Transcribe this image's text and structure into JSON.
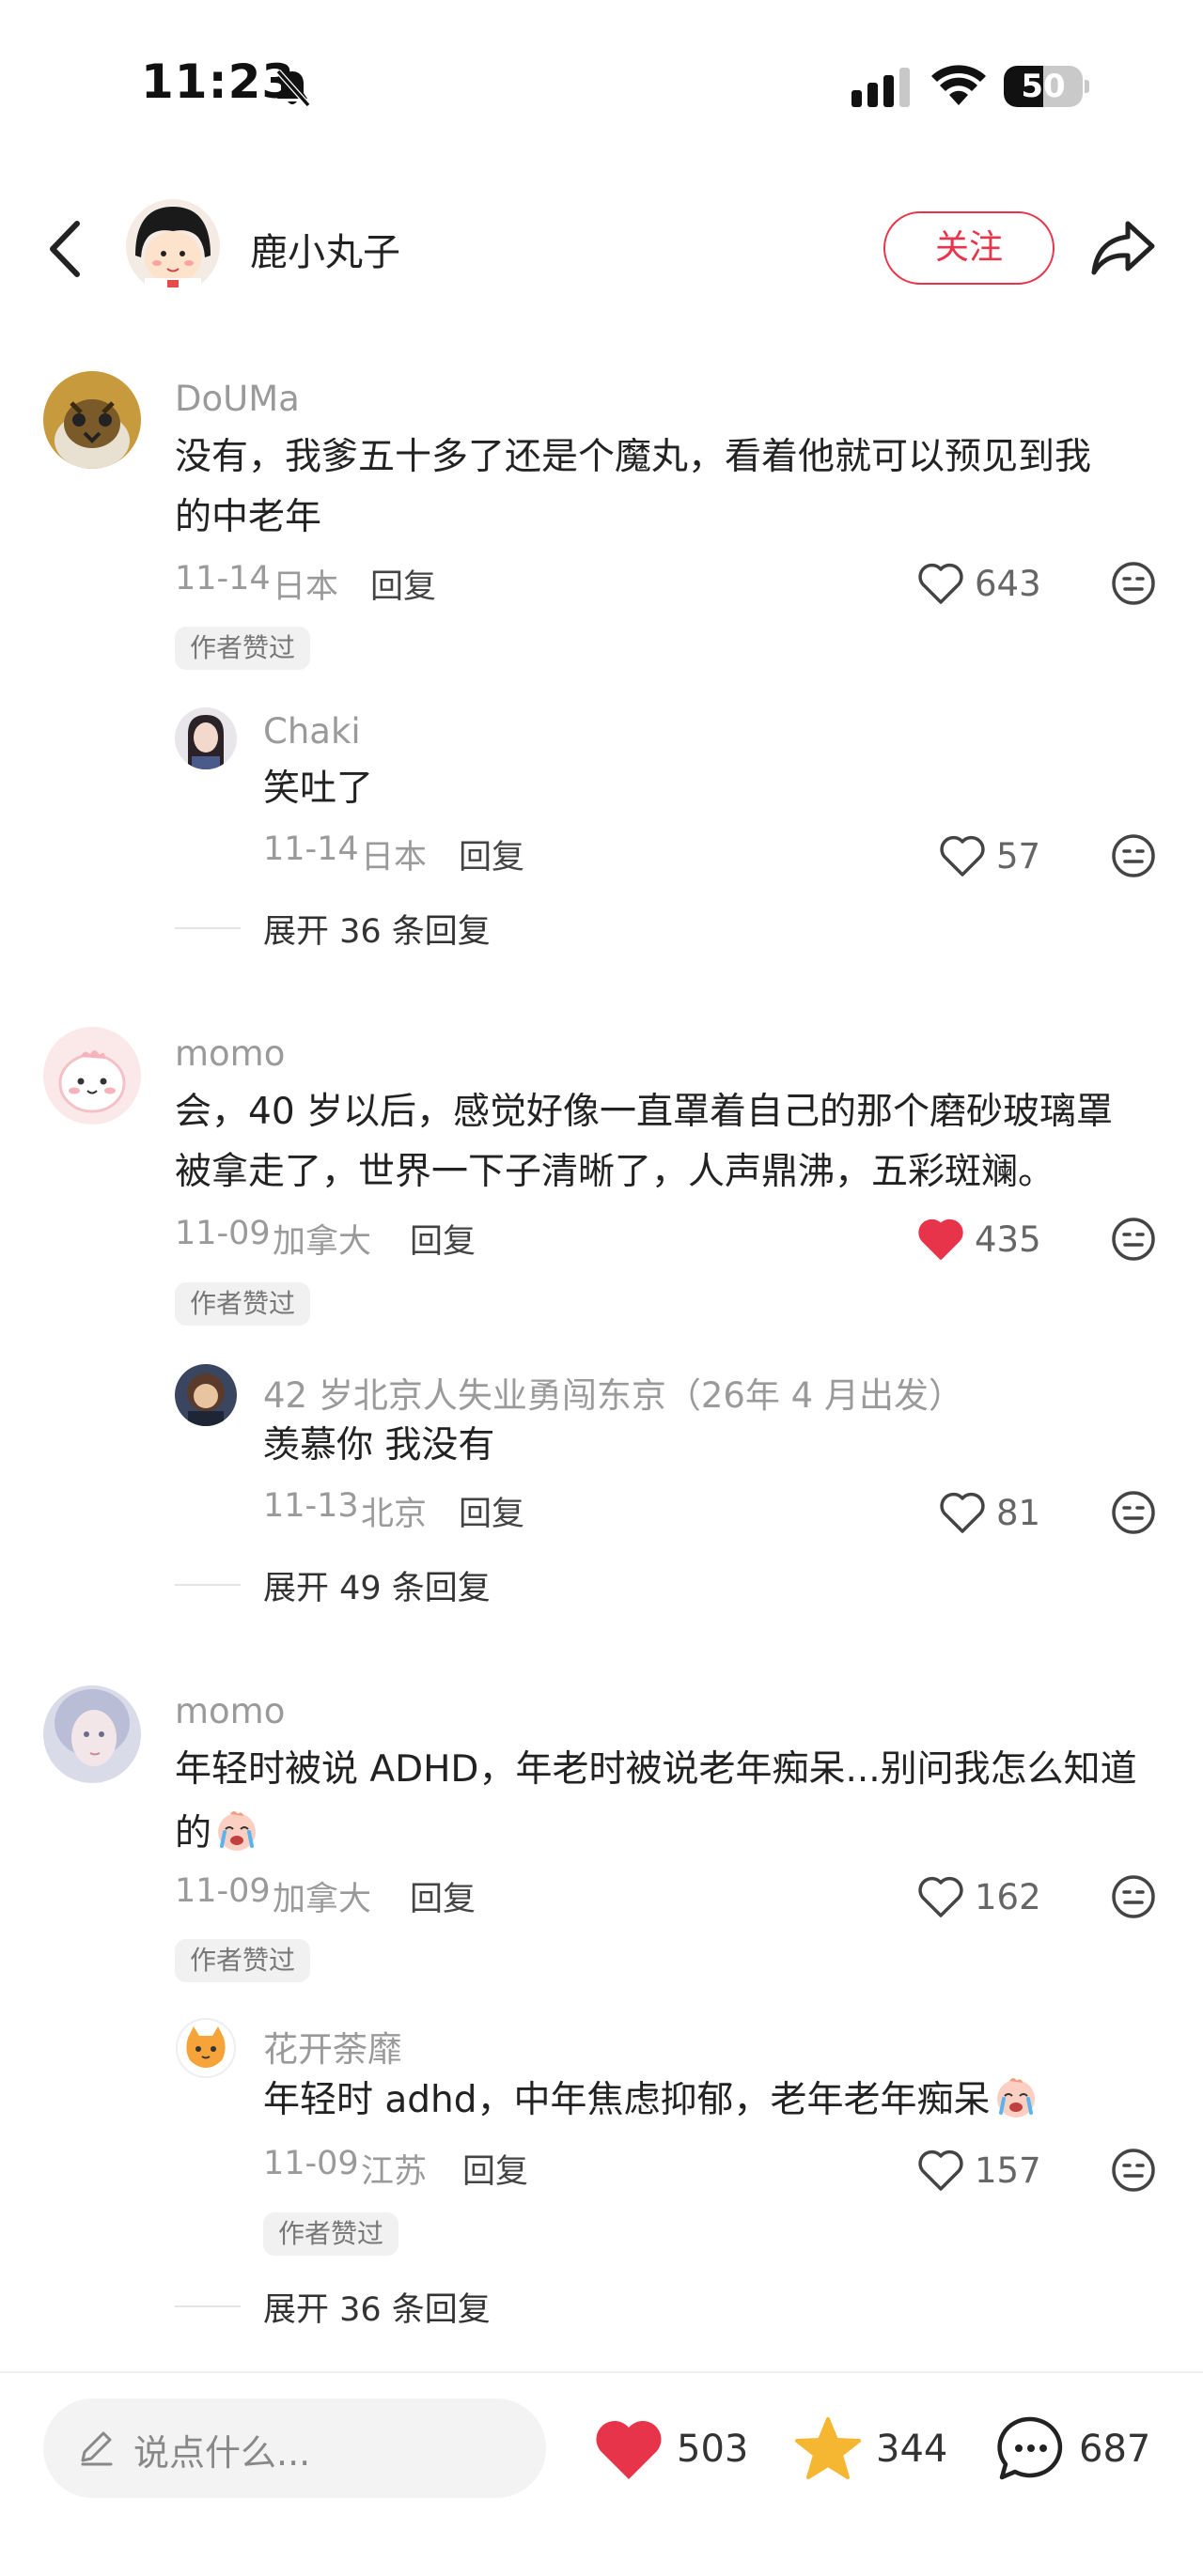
{
  "status_bar": {
    "time": "11:23",
    "battery": "50",
    "battery_level": 0.5
  },
  "header": {
    "author_name": "鹿小丸子",
    "follow_label": "关注",
    "icons": [
      "back-icon",
      "share-icon"
    ]
  },
  "comments": [
    {
      "name": "DoUMa",
      "text_lines": [
        "没有，我爹五十多了还是个魔丸，看着他就可以预见到我",
        "的中老年"
      ],
      "date": "11-14",
      "location": "日本",
      "reply_label": "回复",
      "likes": "643",
      "liked": false,
      "badge": "作者赞过",
      "sub": {
        "name": "Chaki",
        "text": "笑吐了",
        "date": "11-14",
        "location": "日本",
        "reply_label": "回复",
        "likes": "57",
        "liked": false
      },
      "expand_label": "展开 36 条回复"
    },
    {
      "name": "momo",
      "text_lines": [
        "会，40 岁以后，感觉好像一直罩着自己的那个磨砂玻璃罩",
        "被拿走了，世界一下子清晰了，人声鼎沸，五彩斑斓。"
      ],
      "date": "11-09",
      "location": "加拿大",
      "reply_label": "回复",
      "likes": "435",
      "liked": true,
      "badge": "作者赞过",
      "sub": {
        "name": "42 岁北京人失业勇闯东京（26年 4 月出发）",
        "text": "羡慕你 我没有",
        "date": "11-13",
        "location": "北京",
        "reply_label": "回复",
        "likes": "81",
        "liked": false
      },
      "expand_label": "展开 49 条回复"
    },
    {
      "name": "momo",
      "text_lines": [
        "年轻时被说 ADHD，年老时被说老年痴呆...别问我怎么知道",
        "的"
      ],
      "date": "11-09",
      "location": "加拿大",
      "reply_label": "回复",
      "likes": "162",
      "liked": false,
      "badge": "作者赞过",
      "sub": {
        "name": "花开荼靡",
        "text": "年轻时 adhd，中年焦虑抑郁，老年老年痴呆",
        "date": "11-09",
        "location": "江苏",
        "reply_label": "回复",
        "likes": "157",
        "liked": false,
        "badge": "作者赞过"
      },
      "expand_label": "展开 36 条回复"
    }
  ],
  "bottom_bar": {
    "placeholder": "说点什么...",
    "likes": "503",
    "favorites": "344",
    "comments": "687"
  },
  "colors": {
    "accent_red": "#e8344a",
    "star": "#f5b731",
    "muted": "#9a9a9a"
  }
}
